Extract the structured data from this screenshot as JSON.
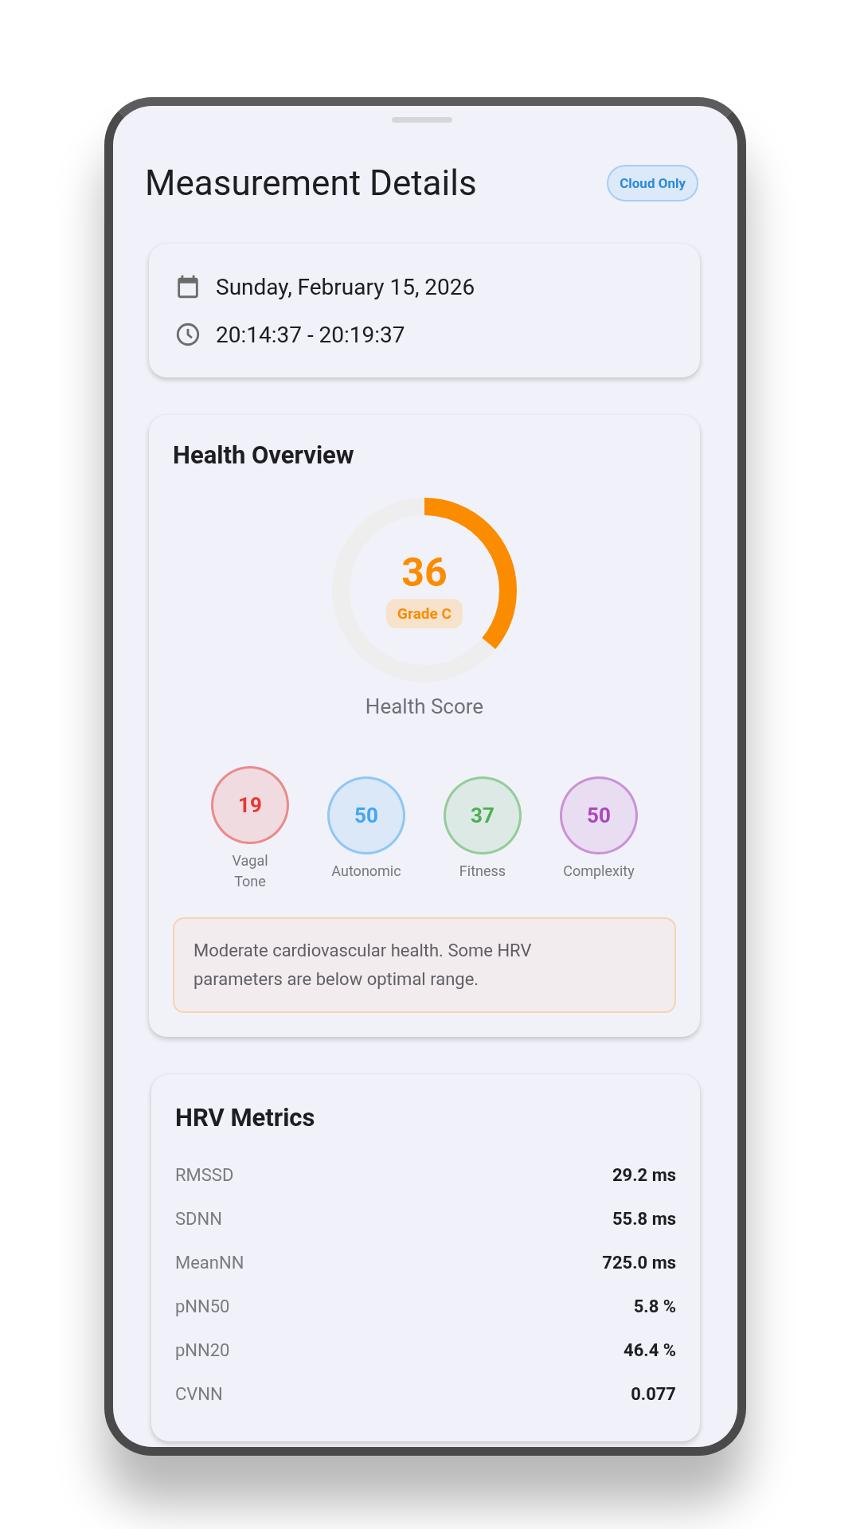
{
  "header": {
    "title": "Measurement Details",
    "badge": "Cloud Only"
  },
  "session": {
    "date": "Sunday, February 15, 2026",
    "time": "20:14:37 - 20:19:37"
  },
  "health_overview": {
    "title": "Health Overview",
    "score": "36",
    "grade": "Grade C",
    "score_label": "Health Score",
    "subscores": [
      {
        "value": "19",
        "label": "Vagal Tone",
        "color": "#e53935"
      },
      {
        "value": "50",
        "label": "Autonomic",
        "color": "#42a5f5"
      },
      {
        "value": "37",
        "label": "Fitness",
        "color": "#4caf50"
      },
      {
        "value": "50",
        "label": "Complexity",
        "color": "#ab47bc"
      }
    ],
    "note": "Moderate cardiovascular health. Some HRV parameters are below optimal range."
  },
  "hrv_metrics": {
    "title": "HRV Metrics",
    "rows": [
      {
        "name": "RMSSD",
        "value": "29.2 ms"
      },
      {
        "name": "SDNN",
        "value": "55.8 ms"
      },
      {
        "name": "MeanNN",
        "value": "725.0 ms"
      },
      {
        "name": "pNN50",
        "value": "5.8 %"
      },
      {
        "name": "pNN20",
        "value": "46.4 %"
      },
      {
        "name": "CVNN",
        "value": "0.077"
      }
    ]
  }
}
